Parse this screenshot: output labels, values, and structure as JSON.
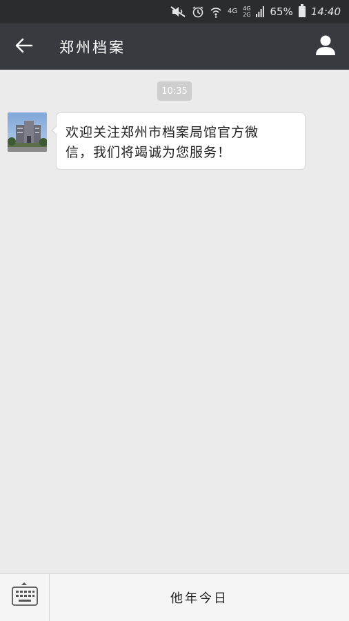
{
  "status_bar": {
    "network_label": "4G",
    "network2_top": "4G",
    "network2_bottom": "2G",
    "battery_percent": "65%",
    "time": "14:40",
    "icons": [
      "mute-icon",
      "alarm-icon",
      "wifi-icon",
      "signal-icon",
      "battery-icon"
    ]
  },
  "header": {
    "title": "郑州档案",
    "back_icon": "arrow-left-icon",
    "profile_icon": "person-icon"
  },
  "chat": {
    "timestamp": "10:35",
    "messages": [
      {
        "sender": "official-account",
        "text": "欢迎关注郑州市档案局馆官方微信，我们将竭诚为您服务！"
      }
    ]
  },
  "bottom_bar": {
    "keyboard_icon": "keyboard-icon",
    "menu_items": [
      {
        "label": "他年今日"
      }
    ]
  },
  "colors": {
    "status_bar_bg": "#2b2c2e",
    "title_bar_bg": "#393a3f",
    "chat_bg": "#ebebeb",
    "bubble_bg": "#ffffff",
    "bottom_bar_bg": "#f5f5f6"
  }
}
